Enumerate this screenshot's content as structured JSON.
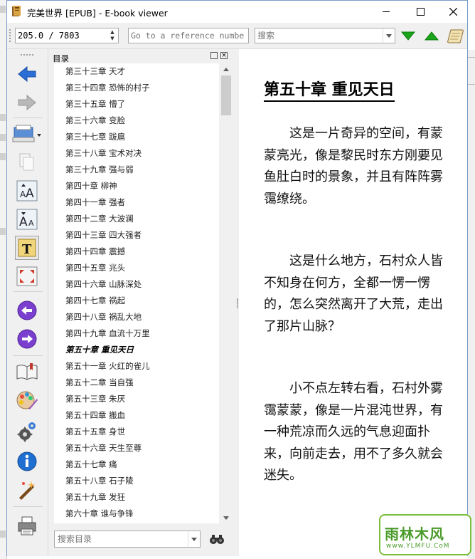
{
  "window": {
    "title": "完美世界 [EPUB] - E-book viewer"
  },
  "toolbar": {
    "position_value": "205.0 / 7803",
    "goto_placeholder": "Go to a reference number...",
    "search_placeholder": "搜索"
  },
  "side_toolbar": {
    "icons": [
      "back-arrow-icon",
      "forward-arrow-icon",
      "open-ebook-icon",
      "copy-icon",
      "font-larger-icon",
      "font-smaller-icon",
      "toc-icon",
      "fullscreen-icon",
      "previous-page-icon",
      "next-page-icon",
      "bookmarks-icon",
      "reference-mode-icon",
      "preferences-icon",
      "metadata-info-icon",
      "inspect-icon",
      "print-icon"
    ]
  },
  "toc": {
    "title": "目录",
    "items": [
      "第三十三章 天才",
      "第三十四章 恐怖的村子",
      "第三十五章 懵了",
      "第三十六章 变脸",
      "第三十七章 跋扈",
      "第三十八章 宝术对决",
      "第三十九章 强与弱",
      "第四十章 柳神",
      "第四十一章 强者",
      "第四十二章 大波澜",
      "第四十三章 四大强者",
      "第四十四章 震撼",
      "第四十五章 兆头",
      "第四十六章 山脉深处",
      "第四十七章 祸起",
      "第四十八章 祸乱大地",
      "第四十九章 血流十万里",
      "第五十章 重见天日",
      "第五十一章 火红的雀儿",
      "第五十二章 当自强",
      "第五十三章 朱厌",
      "第五十四章 搬血",
      "第五十五章 身世",
      "第五十六章 天生至尊",
      "第五十七章 痛",
      "第五十八章 石子陵",
      "第五十九章 发狂",
      "第六十章 谁与争锋"
    ],
    "current_index": 17,
    "search_placeholder": "搜索目录"
  },
  "reader": {
    "chapter_title": "第五十章 重见天日",
    "paragraphs": [
      "这是一片奇异的空间，有蒙蒙亮光，像是黎民时东方刚要见鱼肚白时的景象，并且有阵阵雾霭缭绕。",
      "这是什么地方，石村众人皆不知身在何方，全都一愣一愣的，怎么突然离开了大荒，走出了那片山脉？",
      "小不点左转右看，石村外雾霭蒙蒙，像是一片混沌世界，有一种荒凉而久远的气息迎面扑来，向前走去，用不了多久就会迷失。"
    ]
  },
  "watermark": {
    "main": "雨林木风",
    "sub": "www.YLMFU.CoM"
  },
  "colors": {
    "accent_green": "#1aa51a",
    "icon_blue": "#2b6fd6",
    "watermark_green": "#4a9b2a"
  }
}
